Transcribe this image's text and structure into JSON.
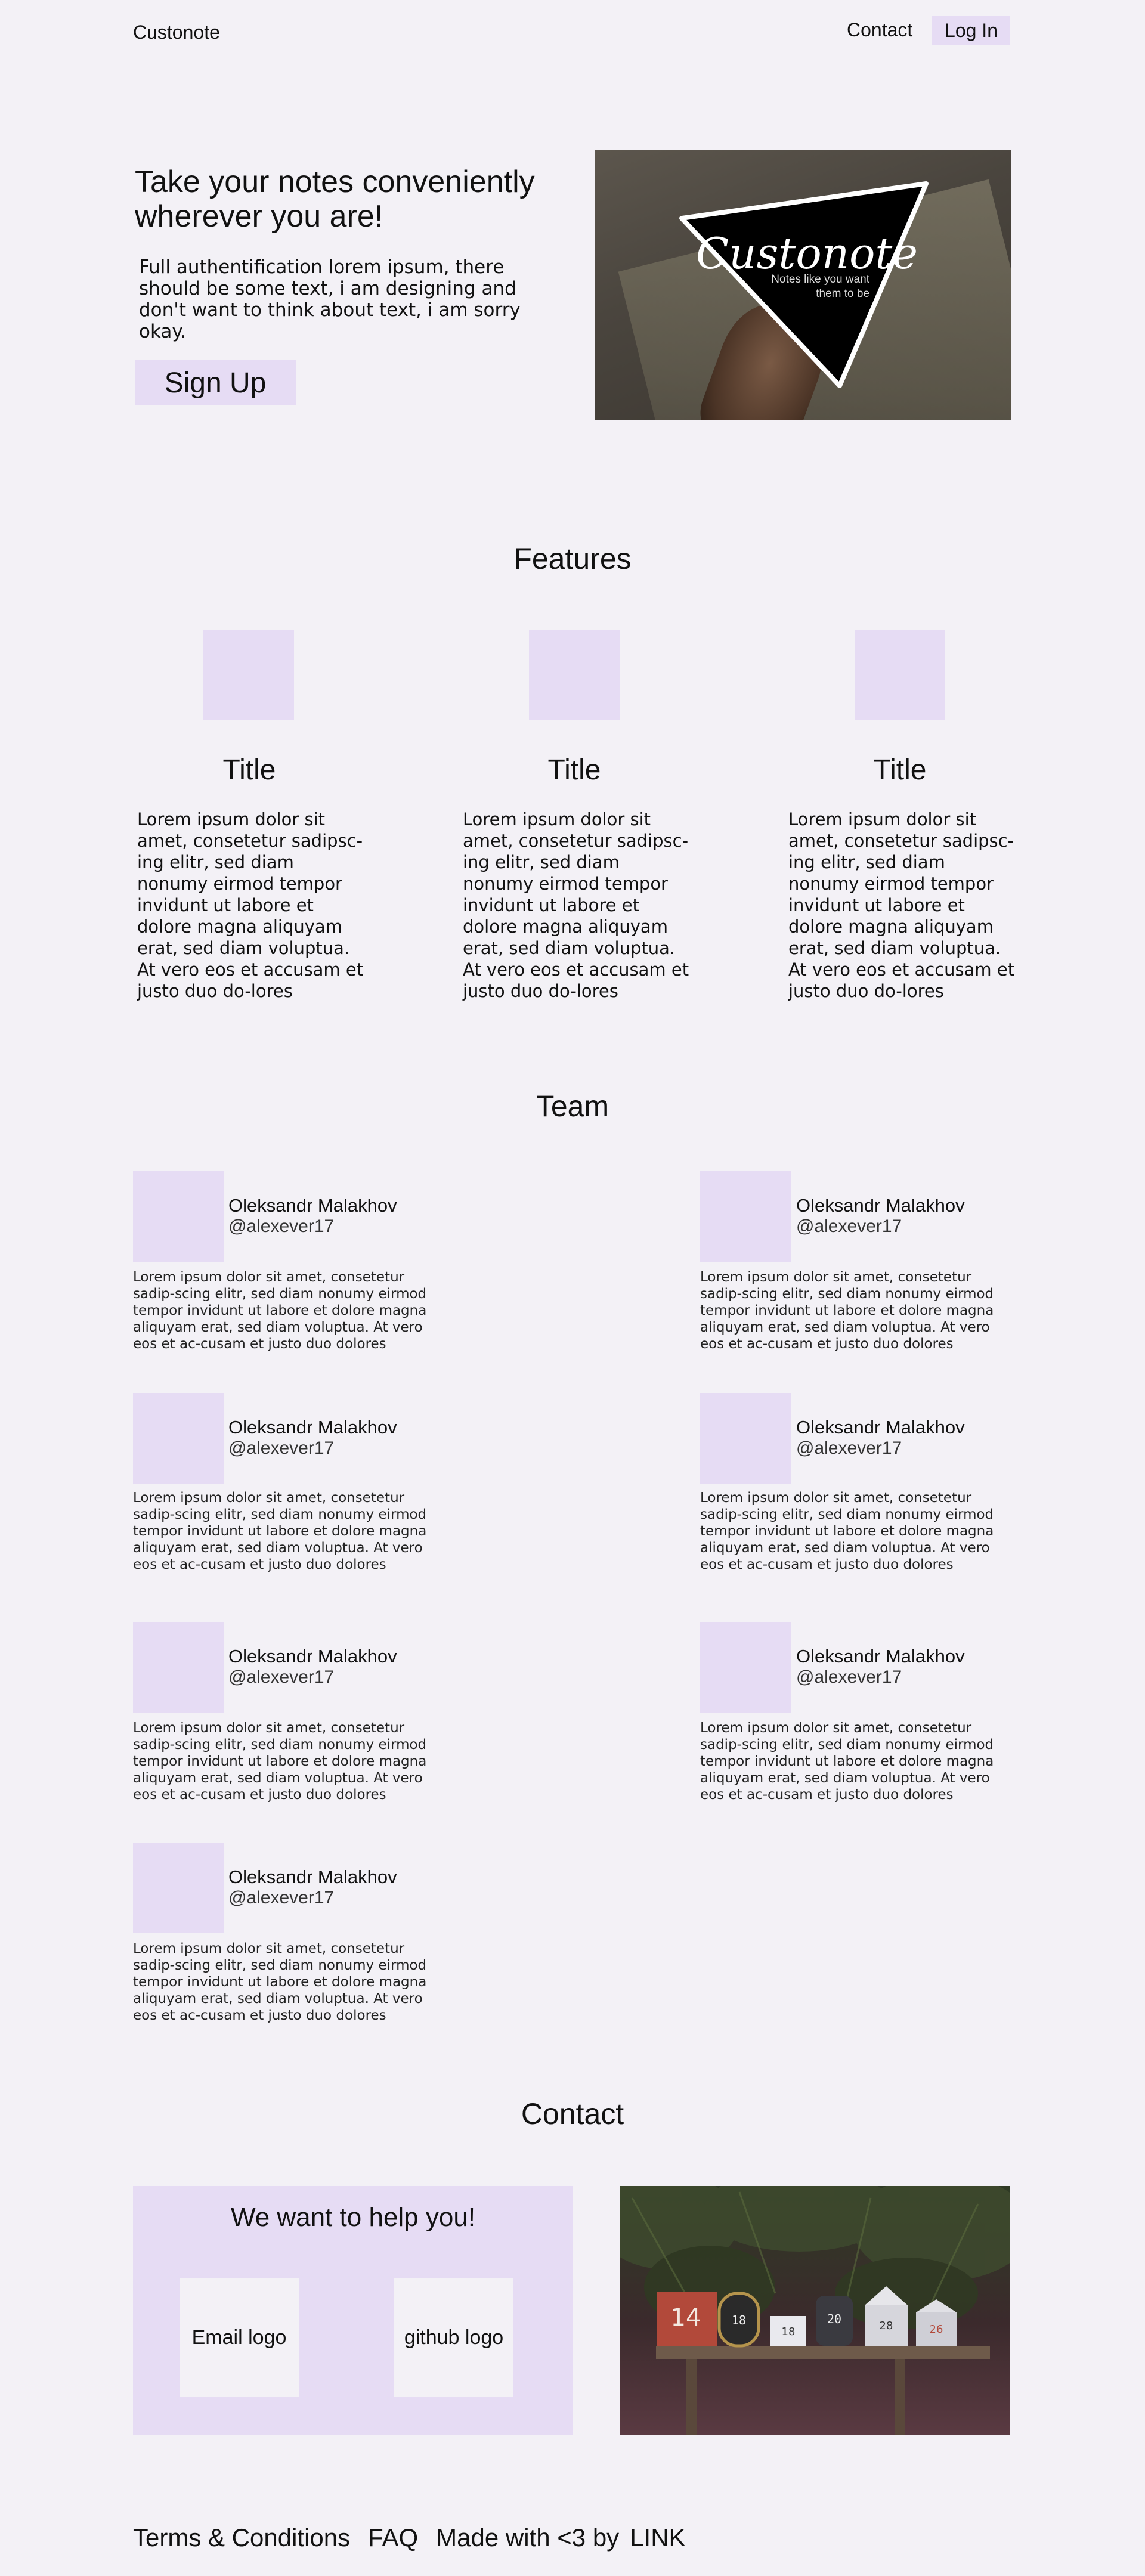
{
  "header": {
    "brand": "Custonote",
    "nav_contact": "Contact",
    "login_label": "Log In"
  },
  "hero": {
    "title": "Take your notes conveniently wherever you are!",
    "description": "Full authentification lorem ipsum, there should be some text, i am designing and don't want to think about text, i am sorry okay.",
    "signup_label": "Sign Up",
    "image_logo_text": "Custonote",
    "image_tagline_1": "Notes like you want",
    "image_tagline_2": "them to be"
  },
  "features": {
    "heading": "Features",
    "items": [
      {
        "title": "Title",
        "text": "Lorem ipsum dolor sit amet, consetetur sadipsc-ing elitr, sed diam nonumy eirmod tempor invidunt ut labore et dolore magna aliquyam erat, sed diam voluptua. At vero eos et accusam et justo duo do-lores"
      },
      {
        "title": "Title",
        "text": "Lorem ipsum dolor sit amet, consetetur sadipsc-ing elitr, sed diam nonumy eirmod tempor invidunt ut labore et dolore magna aliquyam erat, sed diam voluptua. At vero eos et accusam et justo duo do-lores"
      },
      {
        "title": "Title",
        "text": "Lorem ipsum dolor sit amet, consetetur sadipsc-ing elitr, sed diam nonumy eirmod tempor invidunt ut labore et dolore magna aliquyam erat, sed diam voluptua. At vero eos et accusam et justo duo do-lores"
      }
    ]
  },
  "team": {
    "heading": "Team",
    "members": [
      {
        "name": "Oleksandr Malakhov",
        "handle": "@alexever17",
        "bio": "Lorem ipsum dolor sit amet, consetetur sadip-scing elitr, sed diam nonumy eirmod tempor invidunt ut labore et dolore magna aliquyam erat, sed diam voluptua. At vero eos et ac-cusam et justo duo dolores"
      },
      {
        "name": "Oleksandr Malakhov",
        "handle": "@alexever17",
        "bio": "Lorem ipsum dolor sit amet, consetetur sadip-scing elitr, sed diam nonumy eirmod tempor invidunt ut labore et dolore magna aliquyam erat, sed diam voluptua. At vero eos et ac-cusam et justo duo dolores"
      },
      {
        "name": "Oleksandr Malakhov",
        "handle": "@alexever17",
        "bio": "Lorem ipsum dolor sit amet, consetetur sadip-scing elitr, sed diam nonumy eirmod tempor invidunt ut labore et dolore magna aliquyam erat, sed diam voluptua. At vero eos et ac-cusam et justo duo dolores"
      },
      {
        "name": "Oleksandr Malakhov",
        "handle": "@alexever17",
        "bio": "Lorem ipsum dolor sit amet, consetetur sadip-scing elitr, sed diam nonumy eirmod tempor invidunt ut labore et dolore magna aliquyam erat, sed diam voluptua. At vero eos et ac-cusam et justo duo dolores"
      },
      {
        "name": "Oleksandr Malakhov",
        "handle": "@alexever17",
        "bio": "Lorem ipsum dolor sit amet, consetetur sadip-scing elitr, sed diam nonumy eirmod tempor invidunt ut labore et dolore magna aliquyam erat, sed diam voluptua. At vero eos et ac-cusam et justo duo dolores"
      },
      {
        "name": "Oleksandr Malakhov",
        "handle": "@alexever17",
        "bio": "Lorem ipsum dolor sit amet, consetetur sadip-scing elitr, sed diam nonumy eirmod tempor invidunt ut labore et dolore magna aliquyam erat, sed diam voluptua. At vero eos et ac-cusam et justo duo dolores"
      },
      {
        "name": "Oleksandr Malakhov",
        "handle": "@alexever17",
        "bio": "Lorem ipsum dolor sit amet, consetetur sadip-scing elitr, sed diam nonumy eirmod tempor invidunt ut labore et dolore magna aliquyam erat, sed diam voluptua. At vero eos et ac-cusam et justo duo dolores"
      }
    ]
  },
  "contact": {
    "heading": "Contact",
    "box_heading": "We want to help you!",
    "email_label": "Email logo",
    "github_label": "github logo",
    "mailbox_numbers": [
      "14",
      "18",
      "18",
      "20",
      "28",
      "26"
    ]
  },
  "footer": {
    "terms": "Terms & Conditions",
    "faq": "FAQ",
    "made_with": "Made with <3 by",
    "link": "LINK"
  },
  "colors": {
    "background": "#f3f1f6",
    "accent": "#e6dcf4",
    "text": "#111111"
  }
}
